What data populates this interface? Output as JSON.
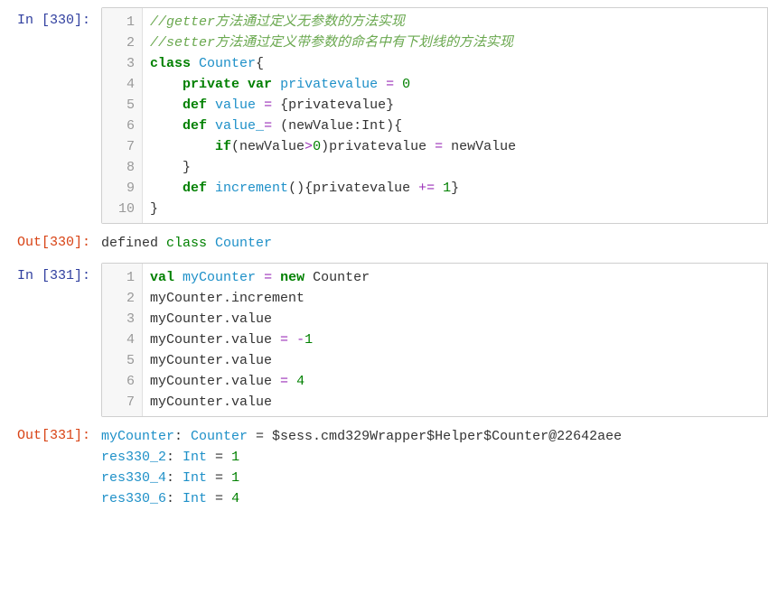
{
  "cells": [
    {
      "kind": "in",
      "prompt": "In  [330]:",
      "lines": [
        [
          {
            "cls": "cm",
            "t": "//getter方法通过定义无参数的方法实现"
          }
        ],
        [
          {
            "cls": "cm",
            "t": "//setter方法通过定义带参数的命名中有下划线的方法实现"
          }
        ],
        [
          {
            "cls": "kwb",
            "t": "class"
          },
          {
            "t": " "
          },
          {
            "cls": "fn",
            "t": "Counter"
          },
          {
            "t": "{"
          }
        ],
        [
          {
            "t": "    "
          },
          {
            "cls": "kwb",
            "t": "private var"
          },
          {
            "t": " "
          },
          {
            "cls": "fn",
            "t": "privatevalue"
          },
          {
            "t": " "
          },
          {
            "cls": "op",
            "t": "="
          },
          {
            "t": " "
          },
          {
            "cls": "num",
            "t": "0"
          }
        ],
        [
          {
            "t": "    "
          },
          {
            "cls": "kwb",
            "t": "def"
          },
          {
            "t": " "
          },
          {
            "cls": "fn",
            "t": "value"
          },
          {
            "t": " "
          },
          {
            "cls": "op",
            "t": "="
          },
          {
            "t": " {privatevalue}"
          }
        ],
        [
          {
            "t": "    "
          },
          {
            "cls": "kwb",
            "t": "def"
          },
          {
            "t": " "
          },
          {
            "cls": "fn",
            "t": "value_"
          },
          {
            "cls": "op",
            "t": "="
          },
          {
            "t": " (newValue:Int){"
          }
        ],
        [
          {
            "t": "        "
          },
          {
            "cls": "kwb",
            "t": "if"
          },
          {
            "t": "(newValue"
          },
          {
            "cls": "op",
            "t": ">"
          },
          {
            "cls": "num",
            "t": "0"
          },
          {
            "t": ")privatevalue "
          },
          {
            "cls": "op",
            "t": "="
          },
          {
            "t": " newValue"
          }
        ],
        [
          {
            "t": "    }"
          }
        ],
        [
          {
            "t": "    "
          },
          {
            "cls": "kwb",
            "t": "def"
          },
          {
            "t": " "
          },
          {
            "cls": "fn",
            "t": "increment"
          },
          {
            "t": "(){privatevalue "
          },
          {
            "cls": "op",
            "t": "+"
          },
          {
            "cls": "op",
            "t": "="
          },
          {
            "t": " "
          },
          {
            "cls": "num",
            "t": "1"
          },
          {
            "t": "}"
          }
        ],
        [
          {
            "t": "}"
          }
        ]
      ]
    },
    {
      "kind": "out",
      "prompt": "Out[330]:",
      "lines": [
        [
          {
            "t": "defined "
          },
          {
            "cls": "out-kw",
            "t": "class"
          },
          {
            "t": " "
          },
          {
            "cls": "out-fn",
            "t": "Counter"
          }
        ]
      ]
    },
    {
      "kind": "in",
      "prompt": "In  [331]:",
      "lines": [
        [
          {
            "cls": "kwb",
            "t": "val"
          },
          {
            "t": " "
          },
          {
            "cls": "fn",
            "t": "myCounter"
          },
          {
            "t": " "
          },
          {
            "cls": "op",
            "t": "="
          },
          {
            "t": " "
          },
          {
            "cls": "kwb",
            "t": "new"
          },
          {
            "t": " Counter"
          }
        ],
        [
          {
            "t": "myCounter.increment"
          }
        ],
        [
          {
            "t": "myCounter.value"
          }
        ],
        [
          {
            "t": "myCounter.value "
          },
          {
            "cls": "op",
            "t": "="
          },
          {
            "t": " "
          },
          {
            "cls": "op",
            "t": "-"
          },
          {
            "cls": "num",
            "t": "1"
          }
        ],
        [
          {
            "t": "myCounter.value"
          }
        ],
        [
          {
            "t": "myCounter.value "
          },
          {
            "cls": "op",
            "t": "="
          },
          {
            "t": " "
          },
          {
            "cls": "num",
            "t": "4"
          }
        ],
        [
          {
            "t": "myCounter.value"
          }
        ]
      ]
    },
    {
      "kind": "out",
      "prompt": "Out[331]:",
      "lines": [
        [
          {
            "cls": "out-id",
            "t": "myCounter"
          },
          {
            "t": ": "
          },
          {
            "cls": "out-fn",
            "t": "Counter"
          },
          {
            "t": " = $sess.cmd329Wrapper$Helper$Counter@22642aee"
          }
        ],
        [
          {
            "cls": "out-id",
            "t": "res330_2"
          },
          {
            "t": ": "
          },
          {
            "cls": "out-fn",
            "t": "Int"
          },
          {
            "t": " = "
          },
          {
            "cls": "num",
            "t": "1"
          }
        ],
        [
          {
            "cls": "out-id",
            "t": "res330_4"
          },
          {
            "t": ": "
          },
          {
            "cls": "out-fn",
            "t": "Int"
          },
          {
            "t": " = "
          },
          {
            "cls": "num",
            "t": "1"
          }
        ],
        [
          {
            "cls": "out-id",
            "t": "res330_6"
          },
          {
            "t": ": "
          },
          {
            "cls": "out-fn",
            "t": "Int"
          },
          {
            "t": " = "
          },
          {
            "cls": "num",
            "t": "4"
          }
        ]
      ]
    }
  ]
}
